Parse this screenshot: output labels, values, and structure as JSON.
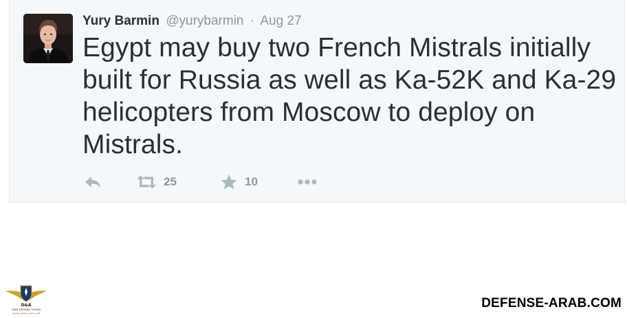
{
  "tweet": {
    "author_name": "Yury Barmin",
    "author_handle": "@yurybarmin",
    "separator": "·",
    "date": "Aug 27",
    "text": "Egypt may buy two French Mistrals initially built for Russia as well as Ka-52K and Ka-29 helicopters from Moscow to deploy on Mistrals."
  },
  "actions": {
    "reply_icon": "reply-icon",
    "retweet_icon": "retweet-icon",
    "retweet_count": "25",
    "favorite_icon": "star-icon",
    "favorite_count": "10",
    "more_icon": "more-dots-icon"
  },
  "footer": {
    "logo_name": "defense-arab-logo",
    "logo_text_line1": "D&A",
    "logo_text_line2": "ARAB DEFENSE FORUM",
    "logo_text_line3": "المنتدى العربي للدفاع والتسليح",
    "watermark": "DEFENSE-ARAB.COM"
  },
  "colors": {
    "card_background": "#f5f8fa",
    "text_primary": "#292f33",
    "text_secondary": "#8899a6",
    "icon_color": "#aab8c2"
  }
}
